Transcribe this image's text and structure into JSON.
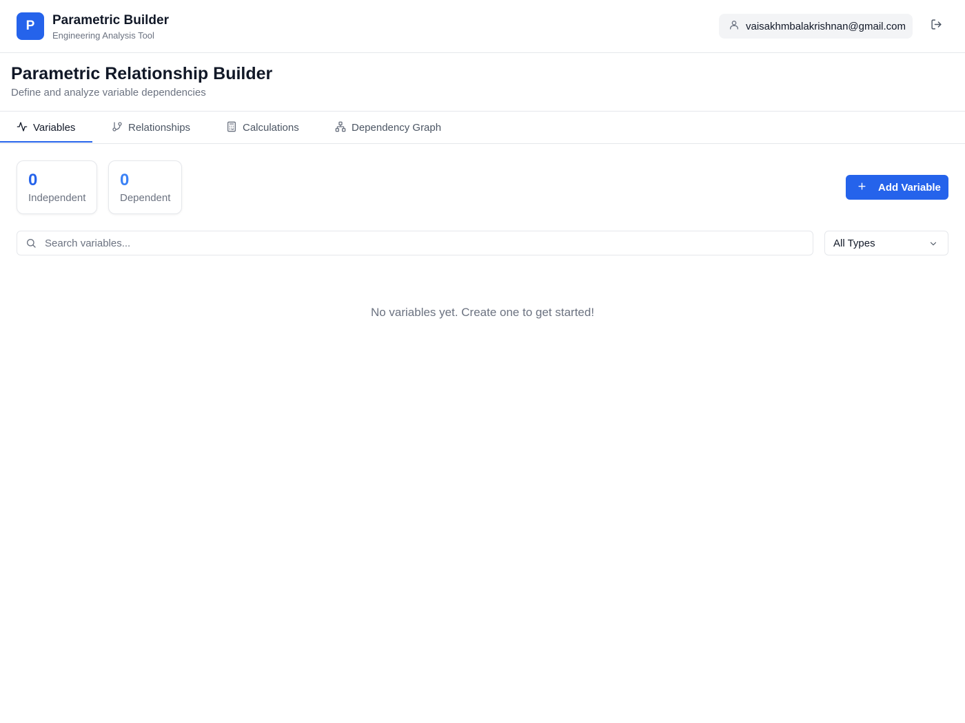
{
  "header": {
    "logo_letter": "P",
    "app_title": "Parametric Builder",
    "app_subtitle": "Engineering Analysis Tool",
    "user_email": "vaisakhmbalakrishnan@gmail.com",
    "user_icon": "user-icon",
    "logout_icon": "log-out-icon"
  },
  "page": {
    "title": "Parametric Relationship Builder",
    "subtitle": "Define and analyze variable dependencies"
  },
  "tabs": [
    {
      "label": "Variables",
      "icon": "activity-icon",
      "active": true
    },
    {
      "label": "Relationships",
      "icon": "git-branch-icon",
      "active": false
    },
    {
      "label": "Calculations",
      "icon": "calculator-icon",
      "active": false
    },
    {
      "label": "Dependency Graph",
      "icon": "network-icon",
      "active": false
    }
  ],
  "stats": [
    {
      "value": "0",
      "label": "Independent"
    },
    {
      "value": "0",
      "label": "Dependent"
    }
  ],
  "actions": {
    "add_variable_label": "Add Variable",
    "add_icon": "plus-icon"
  },
  "search": {
    "placeholder": "Search variables...",
    "value": ""
  },
  "filter": {
    "selected": "All Types"
  },
  "empty_state": {
    "message": "No variables yet. Create one to get started!"
  },
  "colors": {
    "primary": "#2563eb",
    "text": "#111827",
    "muted": "#6b7280",
    "border": "#e5e7eb"
  }
}
